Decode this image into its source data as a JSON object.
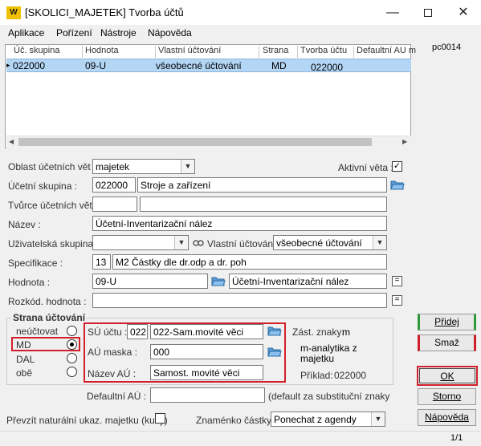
{
  "window": {
    "title": "[SKOLICI_MAJETEK] Tvorba účtů",
    "app_icon_text": "W"
  },
  "menu": [
    "Aplikace",
    "Pořízení",
    "Nástroje",
    "Nápověda"
  ],
  "side_code": "pc0014",
  "grid": {
    "columns": [
      "Úč. skupina",
      "Hodnota",
      "Vlastní účtování",
      "Strana",
      "Tvorba účtu",
      "Defaultní AU m"
    ],
    "rows": [
      {
        "skupina": "022000",
        "hodnota": "09-U",
        "vlastni": "všeobecné účtování",
        "strana": "MD",
        "tvorba": "022000",
        "defaultni": ""
      }
    ]
  },
  "form": {
    "oblast_label": "Oblast účetních vět :",
    "oblast_value": "majetek",
    "aktivni_label": "Aktivní věta :",
    "aktivni_checked": "✓",
    "skupina_label": "Účetní skupina :",
    "skupina_code": "022000",
    "skupina_name": "Stroje a zařízení",
    "tvurce_label": "Tvůrce účetních vět :",
    "tvurce_a": "",
    "tvurce_b": "",
    "nazev_label": "Název :",
    "nazev_value": "Účetní-Inventarizační nález",
    "uziv_label": "Uživatelská skupina :",
    "uziv_value": "",
    "vlastni_label": "Vlastní účtování :",
    "vlastni_value": "všeobecné účtování",
    "spec_label": "Specifikace :",
    "spec_code": "13",
    "spec_value": "M2 Částky dle dr.odp a dr. poh",
    "hodnota_label": "Hodnota :",
    "hodnota_code": "09-U",
    "hodnota_name": "Účetní-Inventarizační nález",
    "rozkod_label": "Rozkód. hodnota :",
    "rozkod_value": ""
  },
  "strana": {
    "title": "Strana účtování",
    "options": [
      {
        "label": "neúčtovat",
        "selected": false
      },
      {
        "label": "MD",
        "selected": true
      },
      {
        "label": "DAL",
        "selected": false
      },
      {
        "label": "obě",
        "selected": false
      }
    ],
    "su_label": "SÚ účtu :",
    "su_code": "022",
    "su_name": "022-Sam.movité věci",
    "au_maska_label": "AÚ maska :",
    "au_maska_value": "000",
    "nazev_au_label": "Název AÚ :",
    "nazev_au_value": "Samost. movité věci",
    "zast_label": "Zást. znaky:",
    "zast_value": "m",
    "zast_desc": "m-analytika z majetku",
    "priklad_label": "Příklad:",
    "priklad_value": "022000"
  },
  "defaultni": {
    "label": "Defaultní AÚ :",
    "value": "",
    "hint": "(default za substituční znaky"
  },
  "bottom": {
    "prevzit_label": "Převzít naturální ukaz. majetku (kusy)",
    "znamenko_label": "Znaménko částky :",
    "znamenko_value": "Ponechat z agendy"
  },
  "buttons": {
    "pridej": "Přidej",
    "smaz": "Smaž",
    "ok": "OK",
    "storno": "Storno",
    "napoveda": "Nápověda"
  },
  "status": {
    "page": "1/1"
  },
  "colors": {
    "highlight_red": "#d0202a",
    "selection_blue": "#b3d6f5",
    "accent_green": "#2e9a3a"
  }
}
